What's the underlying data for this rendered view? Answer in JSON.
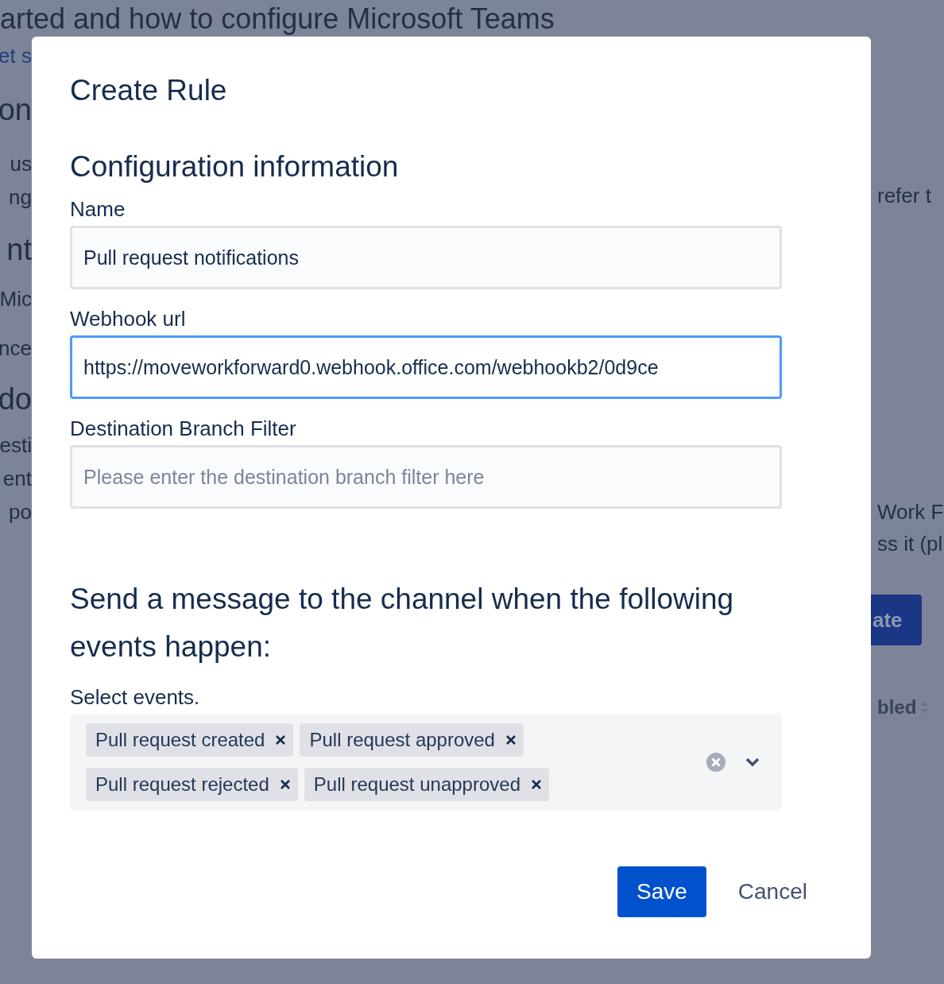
{
  "background_page": {
    "heading": "arted and how to configure Microsoft Teams",
    "left_fragments": [
      {
        "kind": "link",
        "text": "et s"
      },
      {
        "kind": "heading",
        "text": "on"
      },
      {
        "kind": "text",
        "text": "us"
      },
      {
        "kind": "text",
        "text": "ng"
      },
      {
        "kind": "heading",
        "text": "nt"
      },
      {
        "kind": "text",
        "text": "Mic"
      },
      {
        "kind": "text",
        "text": "nce"
      },
      {
        "kind": "heading",
        "text": "do"
      },
      {
        "kind": "text",
        "text": "esti"
      },
      {
        "kind": "text",
        "text": "ent"
      },
      {
        "kind": "text",
        "text": "po"
      }
    ],
    "right_fragments": [
      {
        "kind": "text",
        "text": "refer t"
      },
      {
        "kind": "text",
        "text": "Work F"
      },
      {
        "kind": "text",
        "text": "ss it (pl"
      },
      {
        "kind": "button",
        "text": "ate"
      },
      {
        "kind": "column",
        "text": "bled"
      }
    ]
  },
  "dialog": {
    "title": "Create Rule",
    "section_title": "Configuration information",
    "fields": [
      {
        "label": "Name",
        "value": "Pull request notifications",
        "focused": false
      },
      {
        "label": "Webhook url",
        "value": "https://moveworkforward0.webhook.office.com/webhookb2/0d9ce",
        "focused": true
      },
      {
        "label": "Destination Branch Filter",
        "placeholder": "Please enter the destination branch filter here",
        "focused": false
      }
    ],
    "events_heading": "Send a message to the channel when the following events happen:",
    "events_label": "Select events.",
    "events": [
      "Pull request created",
      "Pull request approved",
      "Pull request rejected",
      "Pull request unapproved"
    ],
    "buttons": [
      {
        "label": "Save",
        "kind": "primary"
      },
      {
        "label": "Cancel",
        "kind": "subtle"
      }
    ]
  }
}
